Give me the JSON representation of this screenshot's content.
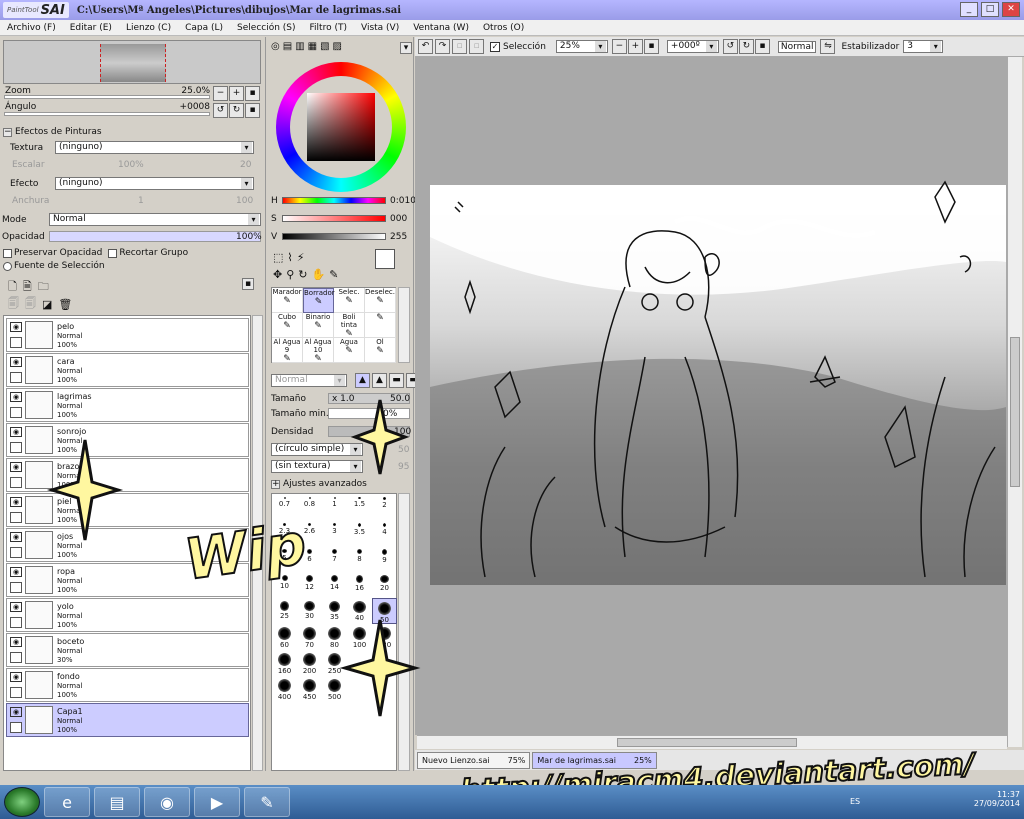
{
  "app": {
    "logo_small": "PaintTool",
    "logo_big": "SAI",
    "title": "C:\\Users\\Mª Angeles\\Pictures\\dibujos\\Mar de lagrimas.sai"
  },
  "window_buttons": [
    "_",
    "□",
    "✕"
  ],
  "menu": [
    "Archivo (F)",
    "Editar (E)",
    "Lienzo (C)",
    "Capa (L)",
    "Selección (S)",
    "Filtro (T)",
    "Vista (V)",
    "Ventana (W)",
    "Otros (O)"
  ],
  "navigator": {
    "zoom_label": "Zoom",
    "zoom_value": "25.0%",
    "angle_label": "Ángulo",
    "angle_value": "+0008"
  },
  "paint_effects": {
    "header": "Efectos de Pinturas",
    "texture_label": "Textura",
    "texture_value": "(ninguno)",
    "scale_label": "Escalar",
    "scale_value": "100%",
    "scale_num": "20",
    "effect_label": "Efecto",
    "effect_value": "(ninguno)",
    "width_label": "Anchura",
    "width_value": "1",
    "width_num": "100"
  },
  "layer_props": {
    "mode_label": "Mode",
    "mode_value": "Normal",
    "opacity_label": "Opacidad",
    "opacity_value": "100%",
    "preserve_label": "Preservar Opacidad",
    "clip_label": "Recortar Grupo",
    "source_label": "Fuente de Selección"
  },
  "layers": [
    {
      "name": "pelo",
      "mode": "Normal",
      "opacity": "100%"
    },
    {
      "name": "cara",
      "mode": "Normal",
      "opacity": "100%"
    },
    {
      "name": "lagrimas",
      "mode": "Normal",
      "opacity": "100%"
    },
    {
      "name": "sonrojo",
      "mode": "Normal",
      "opacity": "100%"
    },
    {
      "name": "brazos",
      "mode": "Normal",
      "opacity": "100%"
    },
    {
      "name": "piel",
      "mode": "Normal",
      "opacity": "100%"
    },
    {
      "name": "ojos",
      "mode": "Normal",
      "opacity": "100%"
    },
    {
      "name": "ropa",
      "mode": "Normal",
      "opacity": "100%"
    },
    {
      "name": "yolo",
      "mode": "Normal",
      "opacity": "100%"
    },
    {
      "name": "boceto",
      "mode": "Normal",
      "opacity": "30%"
    },
    {
      "name": "fondo",
      "mode": "Normal",
      "opacity": "100%"
    },
    {
      "name": "Capa1",
      "mode": "Normal",
      "opacity": "100%"
    }
  ],
  "selected_layer": 11,
  "color": {
    "h_label": "H",
    "h_value": "0:010",
    "s_label": "S",
    "s_value": "000",
    "v_label": "V",
    "v_value": "255"
  },
  "brushes": [
    {
      "name": "Marador"
    },
    {
      "name": "Borrador"
    },
    {
      "name": "Selec."
    },
    {
      "name": "Deselec."
    },
    {
      "name": "Cubo"
    },
    {
      "name": "Binario"
    },
    {
      "name": "Boli tinta"
    },
    {
      "name": ""
    },
    {
      "name": "Al Agua 9"
    },
    {
      "name": "Al Agua 10"
    },
    {
      "name": "Agua"
    },
    {
      "name": "Ol"
    }
  ],
  "brush_settings": {
    "mode_value": "Normal",
    "size_label": "Tamaño",
    "size_mult": "x 1.0",
    "size_value": "50.0",
    "min_size_label": "Tamaño min.",
    "min_size_value": "0%",
    "density_label": "Densidad",
    "density_value": "100",
    "shape_value": "(círculo simple)",
    "shape_num": "50",
    "texture_value": "(sin textura)",
    "texture_num": "95",
    "advanced_label": "Ajustes avanzados"
  },
  "sizes": [
    "0.7",
    "0.8",
    "1",
    "1.5",
    "2",
    "2.3",
    "2.6",
    "3",
    "3.5",
    "4",
    "5",
    "6",
    "7",
    "8",
    "9",
    "10",
    "12",
    "14",
    "16",
    "20",
    "25",
    "30",
    "35",
    "40",
    "50",
    "60",
    "70",
    "80",
    "100",
    "120",
    "160",
    "200",
    "250",
    "",
    "",
    "400",
    "450",
    "500"
  ],
  "selected_size": "50",
  "canvas_toolbar": {
    "selection_label": "Selección",
    "zoom_value": "25%",
    "angle_value": "+000º",
    "blend_value": "Normal",
    "stabilizer_label": "Estabilizador",
    "stabilizer_value": "3"
  },
  "doc_tabs": [
    {
      "name": "Nuevo Lienzo.sai",
      "zoom": "75%"
    },
    {
      "name": "Mar de lagrimas.sai",
      "zoom": "25%"
    }
  ],
  "overlay": {
    "wip": "Wip",
    "url": "http://miracm4.deviantart.com/"
  },
  "taskbar": {
    "lang": "ES",
    "time": "11:37",
    "date": "27/09/2014",
    "apps": [
      "ie-icon",
      "folder-icon",
      "chrome-icon",
      "media-icon",
      "paint-icon"
    ]
  }
}
